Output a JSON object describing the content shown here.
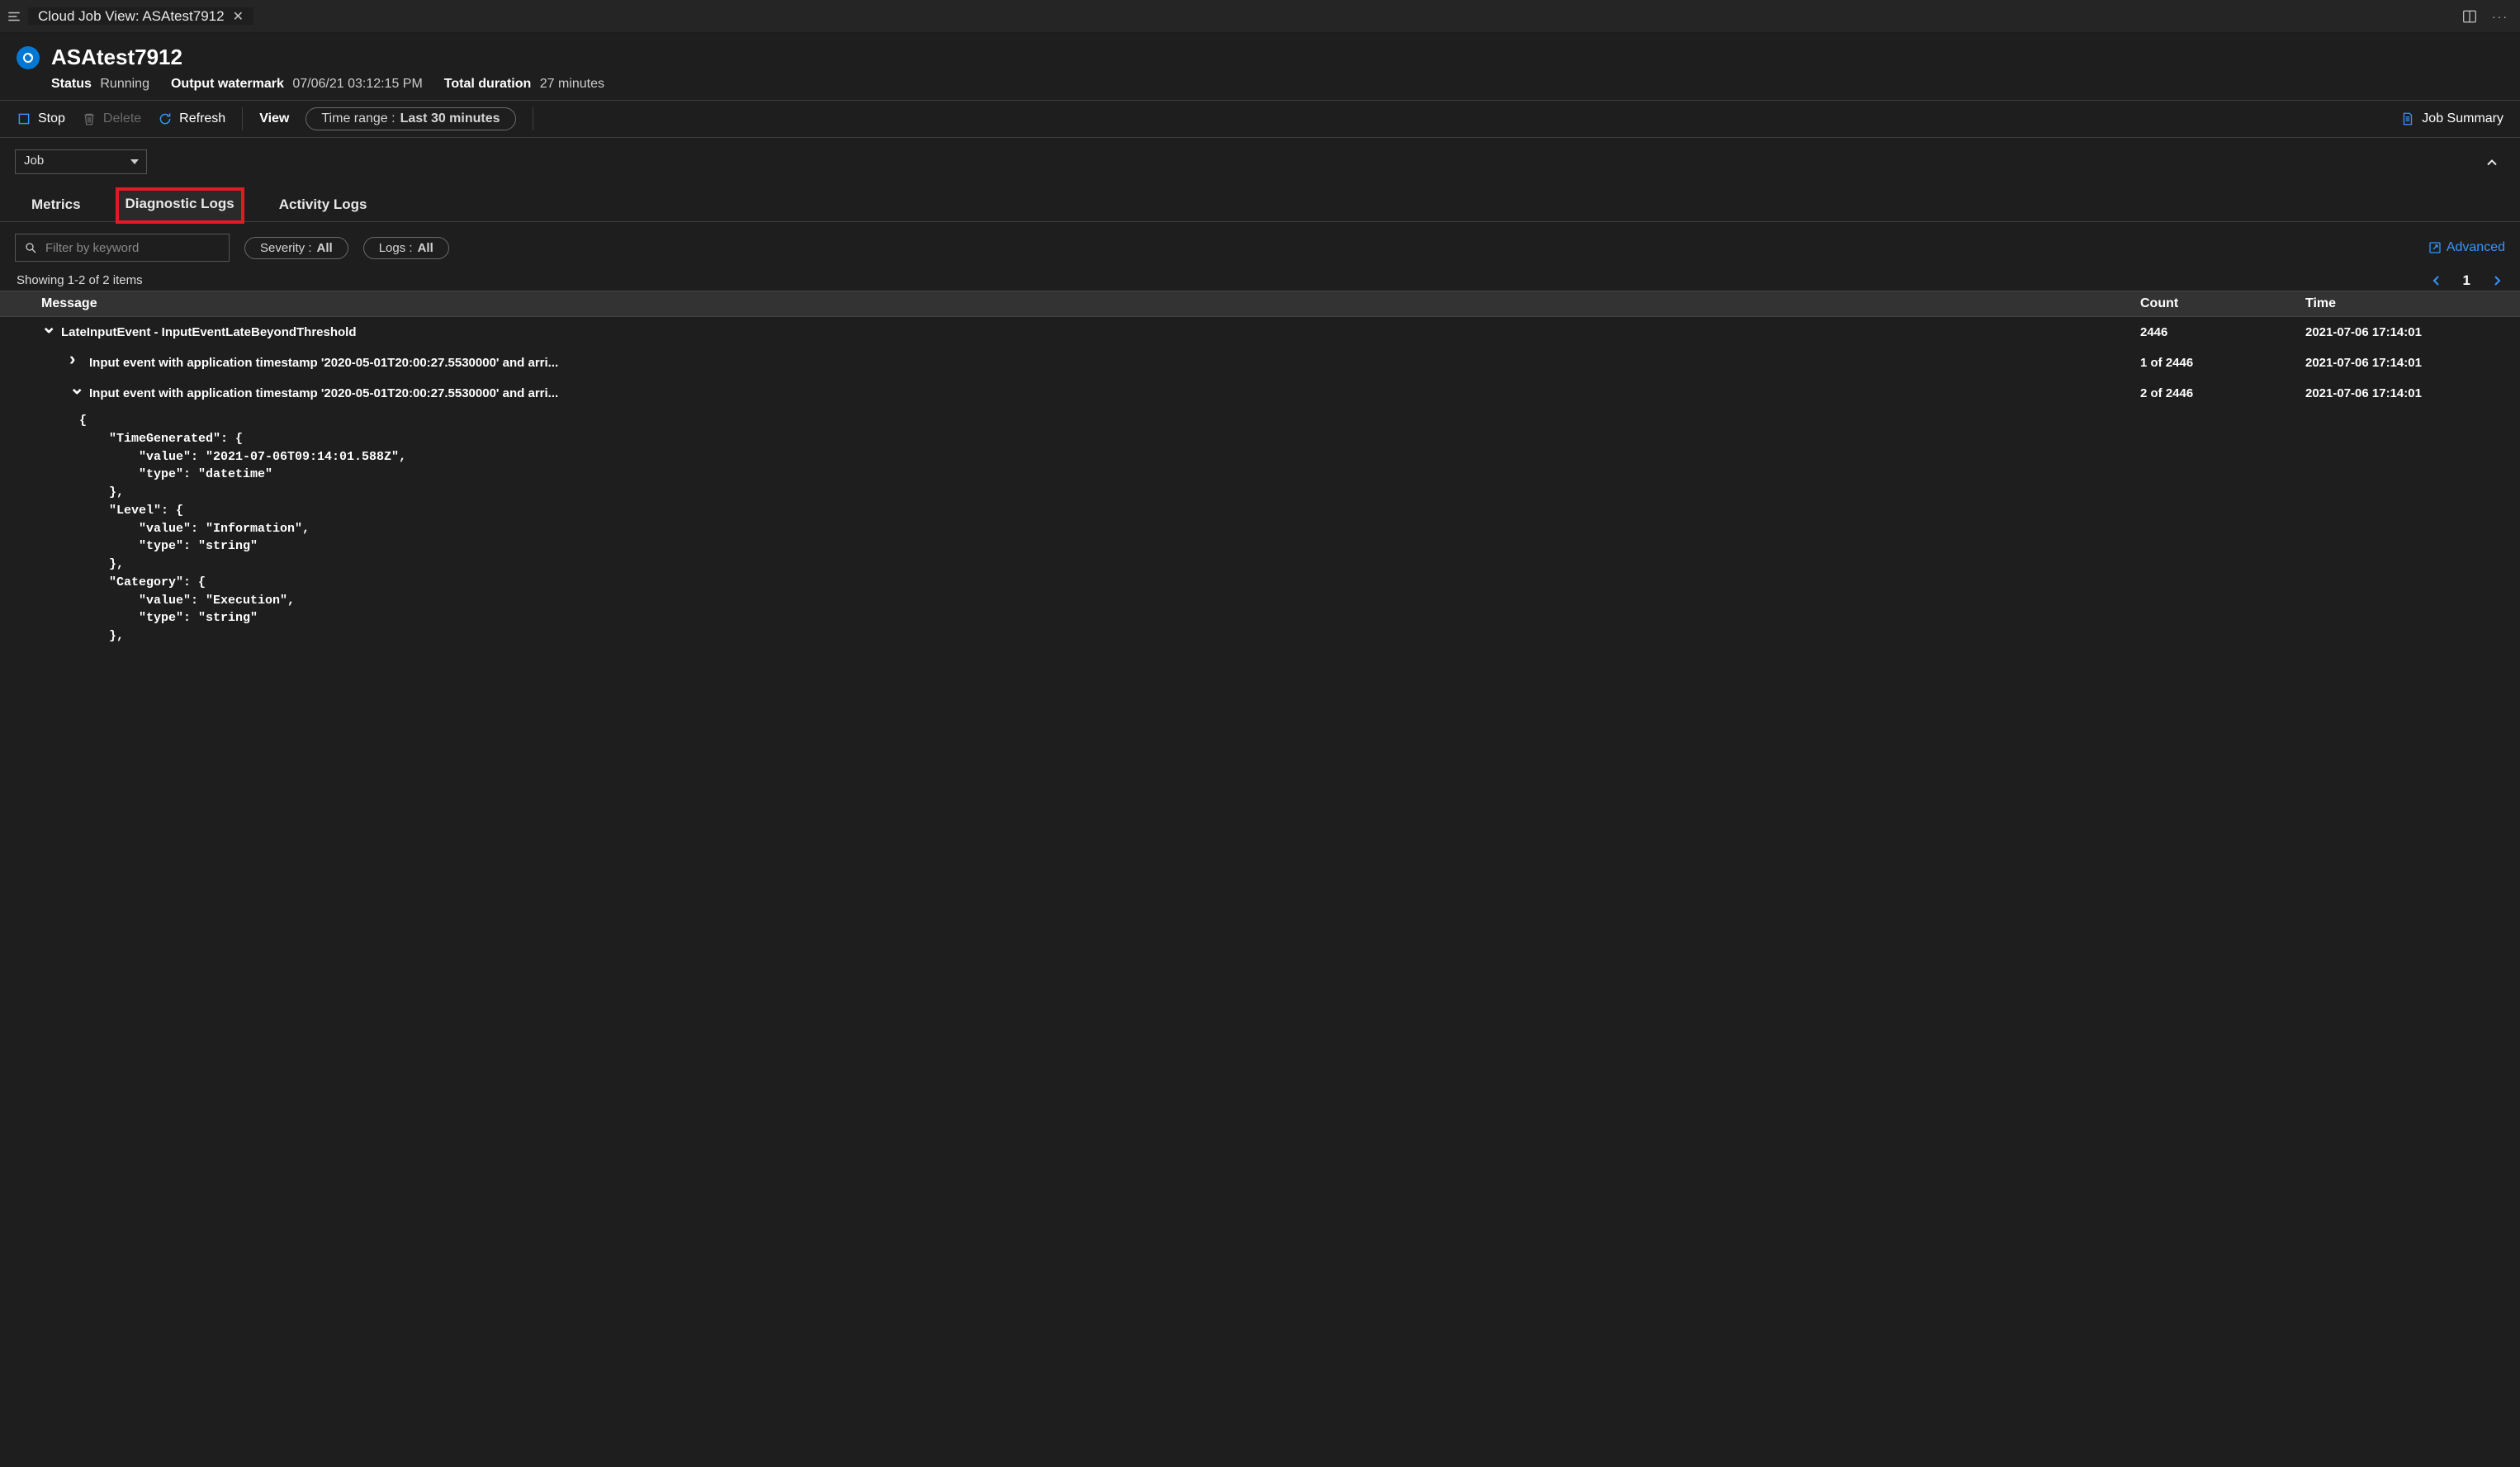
{
  "tab": {
    "title": "Cloud Job View: ASAtest7912"
  },
  "header": {
    "title": "ASAtest7912",
    "status_label": "Status",
    "status_value": "Running",
    "watermark_label": "Output watermark",
    "watermark_value": "07/06/21 03:12:15 PM",
    "duration_label": "Total duration",
    "duration_value": "27 minutes"
  },
  "toolbar": {
    "stop": "Stop",
    "delete": "Delete",
    "refresh": "Refresh",
    "view": "View",
    "time_range_label": "Time range :",
    "time_range_value": "Last 30 minutes",
    "job_summary": "Job Summary"
  },
  "job_select": {
    "value": "Job"
  },
  "tabs": {
    "metrics": "Metrics",
    "diagnostic": "Diagnostic Logs",
    "activity": "Activity Logs"
  },
  "filter": {
    "placeholder": "Filter by keyword",
    "severity_label": "Severity :",
    "severity_value": "All",
    "logs_label": "Logs :",
    "logs_value": "All",
    "advanced": "Advanced"
  },
  "results": {
    "count_text": "Showing 1-2 of 2 items",
    "page": "1"
  },
  "table": {
    "columns": {
      "c0": "Message",
      "c1": "Count",
      "c2": "Time"
    },
    "rows": [
      {
        "level": 0,
        "expanded": true,
        "message": "LateInputEvent - InputEventLateBeyondThreshold",
        "count": "2446",
        "time": "2021-07-06 17:14:01"
      },
      {
        "level": 1,
        "expanded": false,
        "message": "Input event with application timestamp '2020-05-01T20:00:27.5530000' and arri...",
        "count": "1 of 2446",
        "time": "2021-07-06 17:14:01"
      },
      {
        "level": 1,
        "expanded": true,
        "message": "Input event with application timestamp '2020-05-01T20:00:27.5530000' and arri...",
        "count": "2 of 2446",
        "time": "2021-07-06 17:14:01"
      }
    ]
  },
  "json_detail": "{\n    \"TimeGenerated\": {\n        \"value\": \"2021-07-06T09:14:01.588Z\",\n        \"type\": \"datetime\"\n    },\n    \"Level\": {\n        \"value\": \"Information\",\n        \"type\": \"string\"\n    },\n    \"Category\": {\n        \"value\": \"Execution\",\n        \"type\": \"string\"\n    },"
}
